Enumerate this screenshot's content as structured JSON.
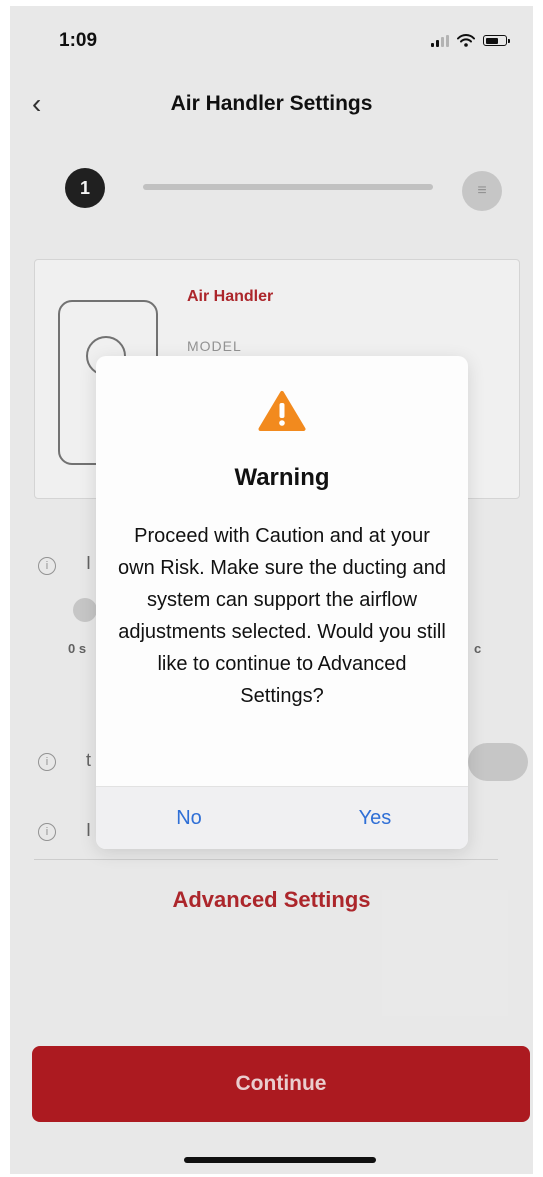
{
  "status_bar": {
    "time": "1:09"
  },
  "nav": {
    "title": "Air Handler Settings",
    "back_glyph": "‹"
  },
  "stepper": {
    "current_step": "1",
    "end_glyph": "≡"
  },
  "card": {
    "title": "Air Handler",
    "model_label": "MODEL",
    "image_glyph": "≡"
  },
  "background": {
    "row_letter_1": "I",
    "slider_min_label": "0 s",
    "slider_max_label": "c",
    "row_letter_2": "t",
    "row_letter_3": "I",
    "info_glyph": "i"
  },
  "advanced_settings_link": "Advanced Settings",
  "continue_button": "Continue",
  "dialog": {
    "title": "Warning",
    "body": "Proceed with Caution and at your own Risk. Make sure the ducting and system can support the airflow adjustments selected. Would you still like to continue to Advanced Settings?",
    "no_label": "No",
    "yes_label": "Yes",
    "warning_color": "#f28a1e"
  },
  "colors": {
    "brand_red": "#b31c22",
    "link_blue": "#2f6fd6"
  }
}
